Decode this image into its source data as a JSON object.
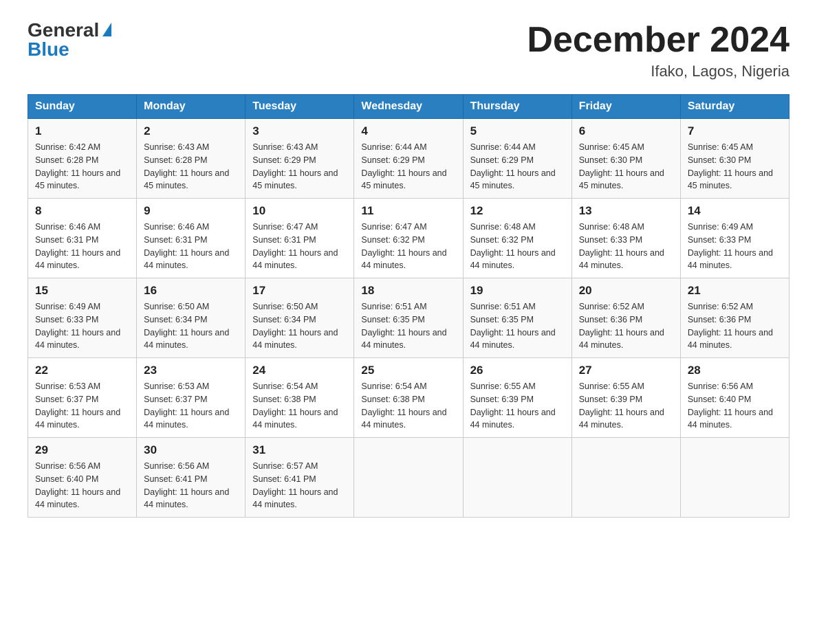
{
  "logo": {
    "general": "General",
    "blue": "Blue"
  },
  "title": "December 2024",
  "location": "Ifako, Lagos, Nigeria",
  "headers": [
    "Sunday",
    "Monday",
    "Tuesday",
    "Wednesday",
    "Thursday",
    "Friday",
    "Saturday"
  ],
  "weeks": [
    [
      {
        "day": "1",
        "sunrise": "6:42 AM",
        "sunset": "6:28 PM",
        "daylight": "11 hours and 45 minutes."
      },
      {
        "day": "2",
        "sunrise": "6:43 AM",
        "sunset": "6:28 PM",
        "daylight": "11 hours and 45 minutes."
      },
      {
        "day": "3",
        "sunrise": "6:43 AM",
        "sunset": "6:29 PM",
        "daylight": "11 hours and 45 minutes."
      },
      {
        "day": "4",
        "sunrise": "6:44 AM",
        "sunset": "6:29 PM",
        "daylight": "11 hours and 45 minutes."
      },
      {
        "day": "5",
        "sunrise": "6:44 AM",
        "sunset": "6:29 PM",
        "daylight": "11 hours and 45 minutes."
      },
      {
        "day": "6",
        "sunrise": "6:45 AM",
        "sunset": "6:30 PM",
        "daylight": "11 hours and 45 minutes."
      },
      {
        "day": "7",
        "sunrise": "6:45 AM",
        "sunset": "6:30 PM",
        "daylight": "11 hours and 45 minutes."
      }
    ],
    [
      {
        "day": "8",
        "sunrise": "6:46 AM",
        "sunset": "6:31 PM",
        "daylight": "11 hours and 44 minutes."
      },
      {
        "day": "9",
        "sunrise": "6:46 AM",
        "sunset": "6:31 PM",
        "daylight": "11 hours and 44 minutes."
      },
      {
        "day": "10",
        "sunrise": "6:47 AM",
        "sunset": "6:31 PM",
        "daylight": "11 hours and 44 minutes."
      },
      {
        "day": "11",
        "sunrise": "6:47 AM",
        "sunset": "6:32 PM",
        "daylight": "11 hours and 44 minutes."
      },
      {
        "day": "12",
        "sunrise": "6:48 AM",
        "sunset": "6:32 PM",
        "daylight": "11 hours and 44 minutes."
      },
      {
        "day": "13",
        "sunrise": "6:48 AM",
        "sunset": "6:33 PM",
        "daylight": "11 hours and 44 minutes."
      },
      {
        "day": "14",
        "sunrise": "6:49 AM",
        "sunset": "6:33 PM",
        "daylight": "11 hours and 44 minutes."
      }
    ],
    [
      {
        "day": "15",
        "sunrise": "6:49 AM",
        "sunset": "6:33 PM",
        "daylight": "11 hours and 44 minutes."
      },
      {
        "day": "16",
        "sunrise": "6:50 AM",
        "sunset": "6:34 PM",
        "daylight": "11 hours and 44 minutes."
      },
      {
        "day": "17",
        "sunrise": "6:50 AM",
        "sunset": "6:34 PM",
        "daylight": "11 hours and 44 minutes."
      },
      {
        "day": "18",
        "sunrise": "6:51 AM",
        "sunset": "6:35 PM",
        "daylight": "11 hours and 44 minutes."
      },
      {
        "day": "19",
        "sunrise": "6:51 AM",
        "sunset": "6:35 PM",
        "daylight": "11 hours and 44 minutes."
      },
      {
        "day": "20",
        "sunrise": "6:52 AM",
        "sunset": "6:36 PM",
        "daylight": "11 hours and 44 minutes."
      },
      {
        "day": "21",
        "sunrise": "6:52 AM",
        "sunset": "6:36 PM",
        "daylight": "11 hours and 44 minutes."
      }
    ],
    [
      {
        "day": "22",
        "sunrise": "6:53 AM",
        "sunset": "6:37 PM",
        "daylight": "11 hours and 44 minutes."
      },
      {
        "day": "23",
        "sunrise": "6:53 AM",
        "sunset": "6:37 PM",
        "daylight": "11 hours and 44 minutes."
      },
      {
        "day": "24",
        "sunrise": "6:54 AM",
        "sunset": "6:38 PM",
        "daylight": "11 hours and 44 minutes."
      },
      {
        "day": "25",
        "sunrise": "6:54 AM",
        "sunset": "6:38 PM",
        "daylight": "11 hours and 44 minutes."
      },
      {
        "day": "26",
        "sunrise": "6:55 AM",
        "sunset": "6:39 PM",
        "daylight": "11 hours and 44 minutes."
      },
      {
        "day": "27",
        "sunrise": "6:55 AM",
        "sunset": "6:39 PM",
        "daylight": "11 hours and 44 minutes."
      },
      {
        "day": "28",
        "sunrise": "6:56 AM",
        "sunset": "6:40 PM",
        "daylight": "11 hours and 44 minutes."
      }
    ],
    [
      {
        "day": "29",
        "sunrise": "6:56 AM",
        "sunset": "6:40 PM",
        "daylight": "11 hours and 44 minutes."
      },
      {
        "day": "30",
        "sunrise": "6:56 AM",
        "sunset": "6:41 PM",
        "daylight": "11 hours and 44 minutes."
      },
      {
        "day": "31",
        "sunrise": "6:57 AM",
        "sunset": "6:41 PM",
        "daylight": "11 hours and 44 minutes."
      },
      null,
      null,
      null,
      null
    ]
  ]
}
